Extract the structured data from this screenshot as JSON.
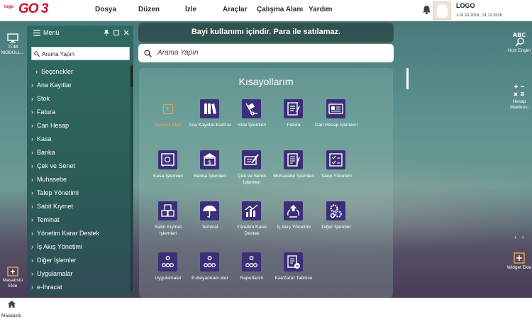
{
  "app": {
    "logo_prefix": "logo",
    "logo_main": "GO 3"
  },
  "menubar": [
    {
      "label": "Dosya"
    },
    {
      "label": "Düzen"
    },
    {
      "label": "İzle"
    },
    {
      "label": "Araçlar"
    },
    {
      "label": "Çalışma Alanı"
    },
    {
      "label": "Yardım"
    }
  ],
  "user": {
    "name": "LOGO",
    "period": "1-01.01.2018...31.12.2018"
  },
  "left_rail": {
    "all_modules": "TÜM MODÜLL...",
    "add_desktop": "Masaüstü Ekle"
  },
  "right_rail": {
    "quick_access": "Hızlı Erişim",
    "calculator": "Hesap Makinesi",
    "add_widget": "Widget Ekle"
  },
  "menu_panel": {
    "title": "Menü",
    "search_placeholder": "Arama Yapın",
    "items": [
      "Seçenekler",
      "Ana Kayıtlar",
      "Stok",
      "Fatura",
      "Cari Hesap",
      "Kasa",
      "Banka",
      "Çek ve Senet",
      "Muhasebe",
      "Talep Yönetimi",
      "Sabit Kıymet",
      "Teminat",
      "Yönetim Karar Destek",
      "İş Akış Yönetimi",
      "Diğer İşlemler",
      "Uygulamalar",
      "e-İhracat"
    ]
  },
  "banner": "Bayi kullanımı içindir. Para ile satılamaz.",
  "main_search_placeholder": "Arama Yapın",
  "shortcuts": {
    "title": "Kısayollarım",
    "tiles": [
      {
        "label": "Kısayol Ekle",
        "icon": "plus-icon"
      },
      {
        "label": "Ana Kayıtlar-Kartl ar",
        "icon": "binders-icon"
      },
      {
        "label": "Stok İşlemleri",
        "icon": "hand-truck-icon"
      },
      {
        "label": "Fatura",
        "icon": "invoice-icon"
      },
      {
        "label": "Cari Hesap İşlemleri",
        "icon": "account-card-icon"
      },
      {
        "label": "Kasa İşlemleri",
        "icon": "safe-icon"
      },
      {
        "label": "Banka İşlemleri",
        "icon": "bank-icon"
      },
      {
        "label": "Çek ve Senet İşlemleri",
        "icon": "check-pen-icon"
      },
      {
        "label": "Muhasebe İşlemleri",
        "icon": "ledger-icon"
      },
      {
        "label": "Talep Yönetimi",
        "icon": "request-list-icon"
      },
      {
        "label": "Sabit Kıymet İşlemleri",
        "icon": "boxes-icon"
      },
      {
        "label": "Teminat",
        "icon": "umbrella-icon"
      },
      {
        "label": "Yönetim Karar Destek",
        "icon": "chart-icon"
      },
      {
        "label": "İş Akış Yönetimi",
        "icon": "workflow-icon"
      },
      {
        "label": "Diğer İşlemler",
        "icon": "gears-icon"
      },
      {
        "label": "Uygulamalar",
        "icon": "dots-icon"
      },
      {
        "label": "E-Beyannam eler",
        "icon": "dots-icon"
      },
      {
        "label": "Raporlarım",
        "icon": "dots-icon"
      },
      {
        "label": "Kar/Zarar Tablosu",
        "icon": "profit-report-icon"
      }
    ]
  },
  "taskbar": {
    "desktop_label": "Masaüstü"
  }
}
